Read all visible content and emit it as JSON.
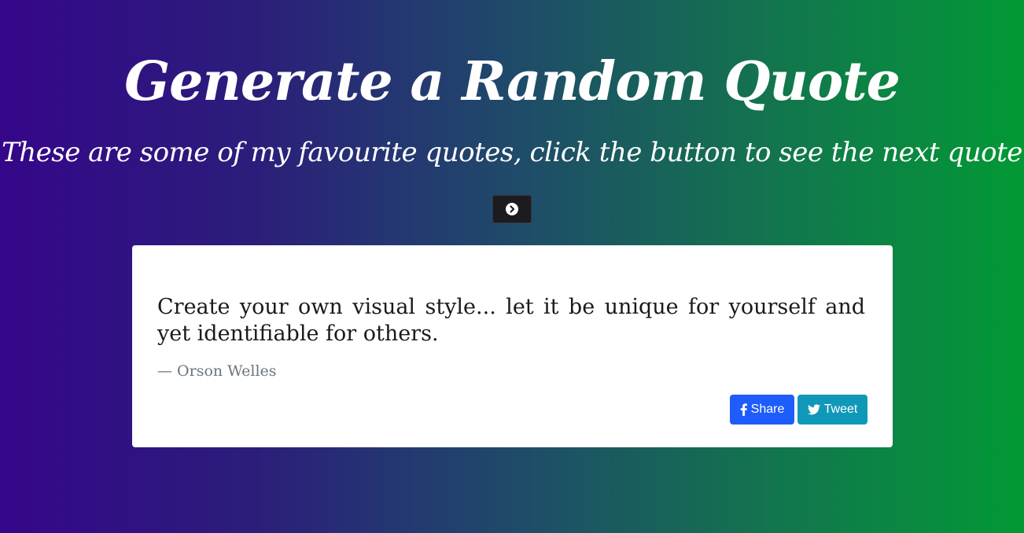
{
  "header": {
    "title": "Generate a Random Quote",
    "subtitle": "These are some of my favourite quotes, click the button to see the next quote"
  },
  "next_button": {
    "icon": "chevron-circle-right-icon"
  },
  "quote": {
    "text": "Create your own visual style... let it be unique for yourself and yet identifiable for others.",
    "author": "— Orson Welles"
  },
  "actions": {
    "share_label": "Share",
    "share_icon": "facebook-icon",
    "tweet_label": "Tweet",
    "tweet_icon": "twitter-icon"
  },
  "colors": {
    "gradient_start": "#35068a",
    "gradient_end": "#029935",
    "share_button": "#1e5dfb",
    "tweet_button": "#1098b8",
    "next_button": "#1c1b1f",
    "card_background": "#ffffff"
  }
}
